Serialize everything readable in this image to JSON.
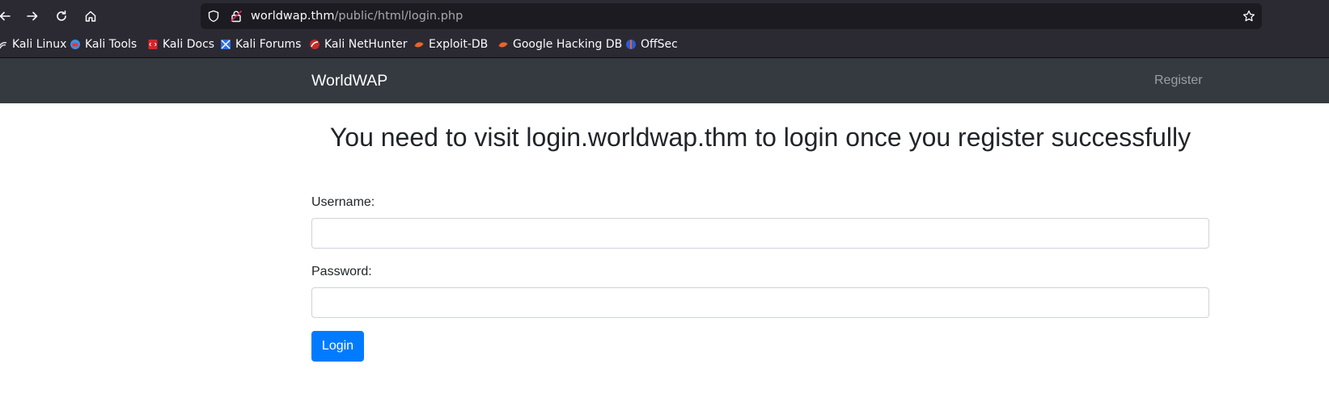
{
  "browser": {
    "url_host": "worldwap.thm",
    "url_path": "/public/html/login.php",
    "bookmarks": [
      {
        "label": "Kali Linux",
        "icon": "kali-linux-icon"
      },
      {
        "label": "Kali Tools",
        "icon": "kali-tools-icon"
      },
      {
        "label": "Kali Docs",
        "icon": "kali-docs-icon"
      },
      {
        "label": "Kali Forums",
        "icon": "kali-forums-icon"
      },
      {
        "label": "Kali NetHunter",
        "icon": "kali-nethunter-icon"
      },
      {
        "label": "Exploit-DB",
        "icon": "exploit-db-icon"
      },
      {
        "label": "Google Hacking DB",
        "icon": "google-hacking-db-icon"
      },
      {
        "label": "OffSec",
        "icon": "offsec-icon"
      }
    ]
  },
  "navbar": {
    "brand": "WorldWAP",
    "register_link": "Register"
  },
  "main": {
    "heading": "You need to visit login.worldwap.thm to login once you register successfully",
    "username_label": "Username:",
    "username_value": "",
    "password_label": "Password:",
    "password_value": "",
    "login_button": "Login"
  },
  "colors": {
    "navbar_bg": "#343a40",
    "primary": "#007bff",
    "chrome_bg": "#2b2a33"
  }
}
